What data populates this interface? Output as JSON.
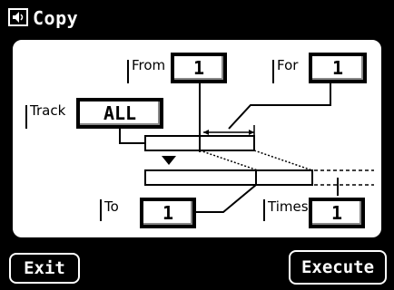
{
  "title": "Copy",
  "labels": {
    "track": "Track",
    "from": "From",
    "for": "For",
    "to": "To",
    "times": "Times"
  },
  "values": {
    "track": "ALL",
    "from": "1",
    "for": "1",
    "to": "1",
    "times": "1"
  },
  "buttons": {
    "exit": "Exit",
    "execute": "Execute"
  },
  "icons": {
    "title": "speaker-icon",
    "arrow": "arrow-down-icon"
  }
}
